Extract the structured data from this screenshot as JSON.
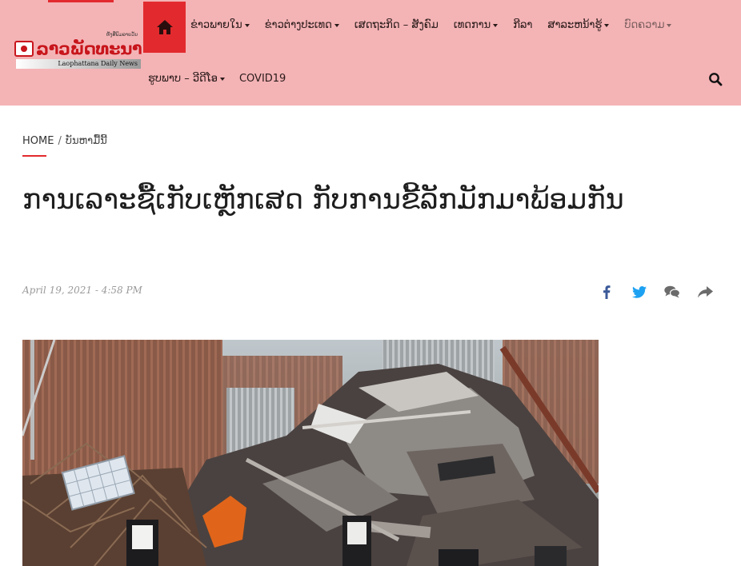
{
  "site": {
    "logo_tagline": "ຫັງສືພິມລາຍວັນ",
    "logo_name": "ລາວພັດທະນາ",
    "logo_subtitle": "Laophattana Daily News",
    "brand_color": "#e22a2e",
    "header_bg": "#f4b3b5"
  },
  "nav": {
    "home_icon": "home-icon",
    "items": [
      {
        "label": "ຂ່າວພາຍໃນ",
        "dropdown": true
      },
      {
        "label": "ຂ່າວຕ່າງປະເທດ",
        "dropdown": true
      },
      {
        "label": "ເສດຖະກິດ – ສັງຄົມ",
        "dropdown": false
      },
      {
        "label": "ເທດການ",
        "dropdown": true
      },
      {
        "label": "ກີລາ",
        "dropdown": false
      },
      {
        "label": "ສາລະຫນ້າຮູ້",
        "dropdown": true
      },
      {
        "label": "ບົດຄວາມ",
        "dropdown": true
      }
    ],
    "items_row2": [
      {
        "label": "ຮູບພາບ – ວີດີໂອ",
        "dropdown": true
      },
      {
        "label": "COVID19",
        "dropdown": false
      }
    ],
    "search_icon": "search-icon"
  },
  "breadcrumb": {
    "home": "HOME",
    "separator": "/",
    "current": "ບັນຫາມື້ນີ້"
  },
  "article": {
    "title": "ການເລາະຊື້ເກັບເຫຼັກເສດ ກັບການຂີ້ລັກມັກມາພ້ອມກັນ",
    "date": "April 19, 2021 - 4:58 PM",
    "share_icons": [
      "facebook-icon",
      "twitter-icon",
      "comment-icon",
      "share-icon"
    ],
    "share_colors": {
      "facebook": "#3b5998",
      "twitter": "#1da1f2",
      "comment": "#6b6b6b",
      "share": "#6b6b6b"
    }
  }
}
